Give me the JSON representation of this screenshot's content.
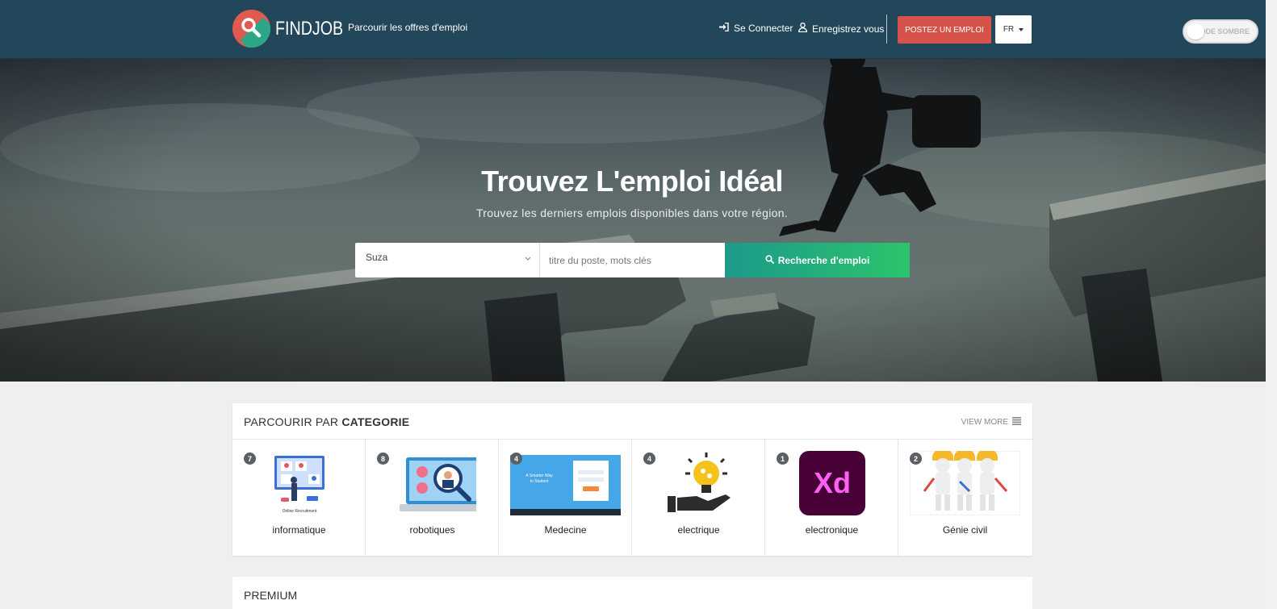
{
  "header": {
    "logo_text": "FINDJOB",
    "browse_label": "Parcourir les offres d'emploi",
    "login_label": "Se Connecter",
    "register_label": "Enregistrez vous",
    "post_job_label": "POSTEZ UN EMPLOI",
    "language": "FR",
    "dark_mode_label": "MODE SOMBRE"
  },
  "hero": {
    "title": "Trouvez L'emploi Idéal",
    "subtitle": "Trouvez les derniers emplois disponibles dans votre région.",
    "location_value": "Suza",
    "search_placeholder": "titre du poste, mots clés",
    "search_button": "Recherche d'emploi"
  },
  "categories": {
    "title_prefix": "PARCOURIR PAR",
    "title_strong": "CATEGORIE",
    "view_more": "VIEW MORE",
    "items": [
      {
        "name": "informatique",
        "count": "7",
        "icon": "online-recruitment-icon"
      },
      {
        "name": "robotiques",
        "count": "8",
        "icon": "laptop-search-icon"
      },
      {
        "name": "Medecine",
        "count": "4",
        "icon": "website-screenshot"
      },
      {
        "name": "electrique",
        "count": "4",
        "icon": "lightbulb-hand-icon"
      },
      {
        "name": "electronique",
        "count": "1",
        "icon": "adobe-xd-icon"
      },
      {
        "name": "Génie civil",
        "count": "2",
        "icon": "construction-workers-icon"
      }
    ]
  },
  "premium": {
    "title": "PREMIUM"
  },
  "colors": {
    "header_bg": "#23475a",
    "post_button": "#d6524a",
    "search_gradient_start": "#1c9a8a",
    "search_gradient_end": "#2bc46c",
    "xd_purple": "#470137",
    "xd_pink": "#ff61f6"
  }
}
